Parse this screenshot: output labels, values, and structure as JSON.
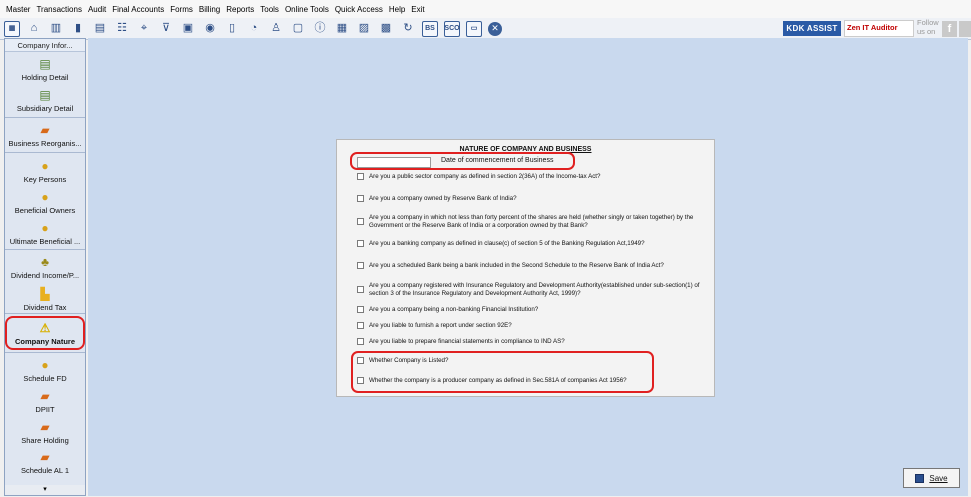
{
  "menu": [
    "Master",
    "Transactions",
    "Audit",
    "Final Accounts",
    "Forms",
    "Billing",
    "Reports",
    "Tools",
    "Online Tools",
    "Quick Access",
    "Help",
    "Exit"
  ],
  "toolbar": {
    "icons": [
      "calculator-icon",
      "home-icon",
      "building-icon",
      "bar-chart-icon",
      "calendar-grid-icon",
      "group-icon",
      "filter-icon",
      "filter-arrow-icon",
      "save-disk-icon",
      "toggle-icon",
      "document-icon",
      "pie-chart-icon",
      "account-icon",
      "copy-icon",
      "info-icon",
      "calculator2-icon",
      "report-icon",
      "calendar-icon",
      "refresh-icon",
      "bs-icon",
      "sco-icon",
      "doc-box-icon",
      "close-icon"
    ],
    "bs_label": "BS",
    "sco_label": "SCO",
    "kdk_assist": "KDK ASSIST",
    "zen_label": "Zen IT Auditor",
    "follow_label": "Follow us on",
    "facebook_glyph": "f"
  },
  "sidebar": {
    "header": "Company Infor...",
    "items": [
      {
        "label": "Holding Detail",
        "icon": "document-icon"
      },
      {
        "label": "Subsidiary Detail",
        "icon": "document-icon"
      },
      {
        "label": "Business Reorganis...",
        "icon": "briefcase-icon"
      },
      {
        "label": "Key Persons",
        "icon": "person-icon"
      },
      {
        "label": "Beneficial Owners",
        "icon": "person-icon"
      },
      {
        "label": "Ultimate Beneficial ...",
        "icon": "person-icon"
      },
      {
        "label": "Dividend Income/P...",
        "icon": "money-bag-icon"
      },
      {
        "label": "Dividend Tax",
        "icon": "folder-icon"
      },
      {
        "label": "Company Nature",
        "icon": "warning-icon"
      },
      {
        "label": "Schedule FD",
        "icon": "person-icon"
      },
      {
        "label": "DPIIT",
        "icon": "briefcase-icon"
      },
      {
        "label": "Share Holding",
        "icon": "briefcase-icon"
      },
      {
        "label": "Schedule AL 1",
        "icon": "briefcase-icon"
      }
    ],
    "active": "Company Nature",
    "scroll_glyph": "▾"
  },
  "form": {
    "title": "NATURE OF COMPANY AND BUSINESS",
    "date_input_value": "",
    "date_label": "Date of commencement of Business",
    "questions": [
      "Are you a public sector company as defined in section 2(36A) of the Income-tax Act?",
      "Are you a company owned by Reserve Bank of India?",
      "Are you a company in which not less than forty percent of the shares are held (whether singly or taken together) by the Government or the Reserve Bank of India or a corporation owned by that Bank?",
      "Are you a banking company as defined in clause(c) of section 5 of the Banking Regulation Act,1949?",
      "Are you a scheduled Bank being a bank included in the Second Schedule to the Reserve Bank of India Act?",
      "Are you a company registered with Insurance Regulatory and Development Authority(established under sub-section(1) of section 3 of the Insurance Regulatory and Development Authority Act, 1999)?",
      "Are you a company being a non-banking Financial Institution?",
      "Are you liable to furnish a report under section 92E?",
      "Are you liable to prepare financial statements in compliance to IND AS?",
      "Whether Company is Listed?",
      "Whether the company is a producer company as defined in Sec.581A of companies Act 1956?"
    ]
  },
  "save_label": "Save"
}
